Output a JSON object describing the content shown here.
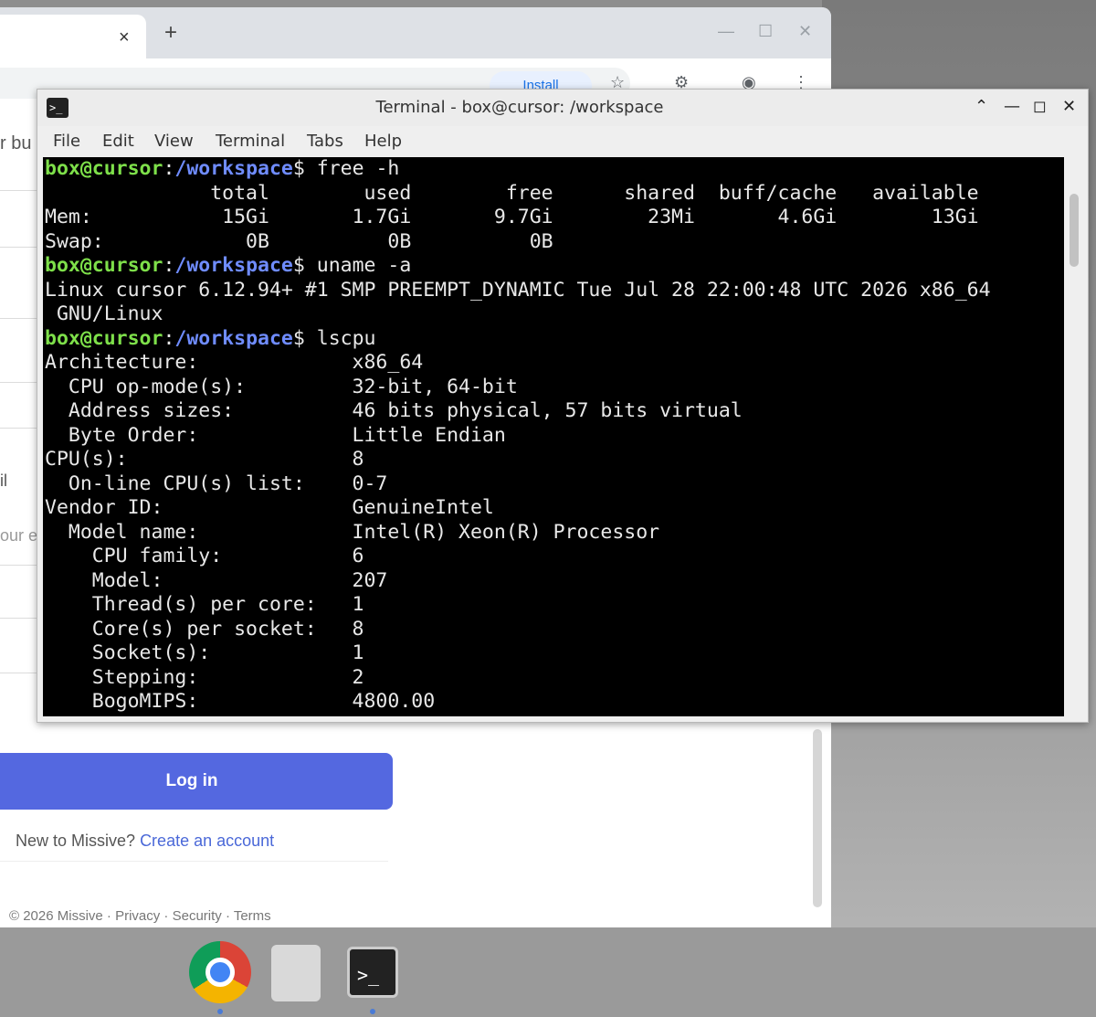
{
  "browser": {
    "tab_close_icon": "×",
    "new_tab_icon": "+",
    "install_label": "Install",
    "page_fragments": [
      "r bu",
      "il",
      "our e"
    ],
    "login_button": "Log in",
    "new_to_text": "New to Missive?",
    "create_account_link": "Create an account",
    "footer": "© 2026 Missive · Privacy · Security · Terms"
  },
  "terminal": {
    "title": "Terminal - box@cursor: /workspace",
    "menu": [
      "File",
      "Edit",
      "View",
      "Terminal",
      "Tabs",
      "Help"
    ],
    "user_host": "box@cursor",
    "path": "/workspace",
    "prompt_sign": "$",
    "commands": [
      "free -h",
      "uname -a",
      "lscpu"
    ],
    "free_output": [
      "              total        used        free      shared  buff/cache   available",
      "Mem:           15Gi       1.7Gi       9.7Gi        23Mi       4.6Gi        13Gi",
      "Swap:            0B          0B          0B"
    ],
    "uname_output": [
      "Linux cursor 6.12.94+ #1 SMP PREEMPT_DYNAMIC Tue Jul 28 22:00:48 UTC 2026 x86_64",
      " GNU/Linux"
    ],
    "lscpu_output": [
      "Architecture:             x86_64",
      "  CPU op-mode(s):         32-bit, 64-bit",
      "  Address sizes:          46 bits physical, 57 bits virtual",
      "  Byte Order:             Little Endian",
      "CPU(s):                   8",
      "  On-line CPU(s) list:    0-7",
      "Vendor ID:                GenuineIntel",
      "  Model name:             Intel(R) Xeon(R) Processor",
      "    CPU family:           6",
      "    Model:                207",
      "    Thread(s) per core:   1",
      "    Core(s) per socket:   8",
      "    Socket(s):            1",
      "    Stepping:             2",
      "    BogoMIPS:             4800.00"
    ]
  },
  "dock": {
    "terminal_icon_text": ">_"
  }
}
